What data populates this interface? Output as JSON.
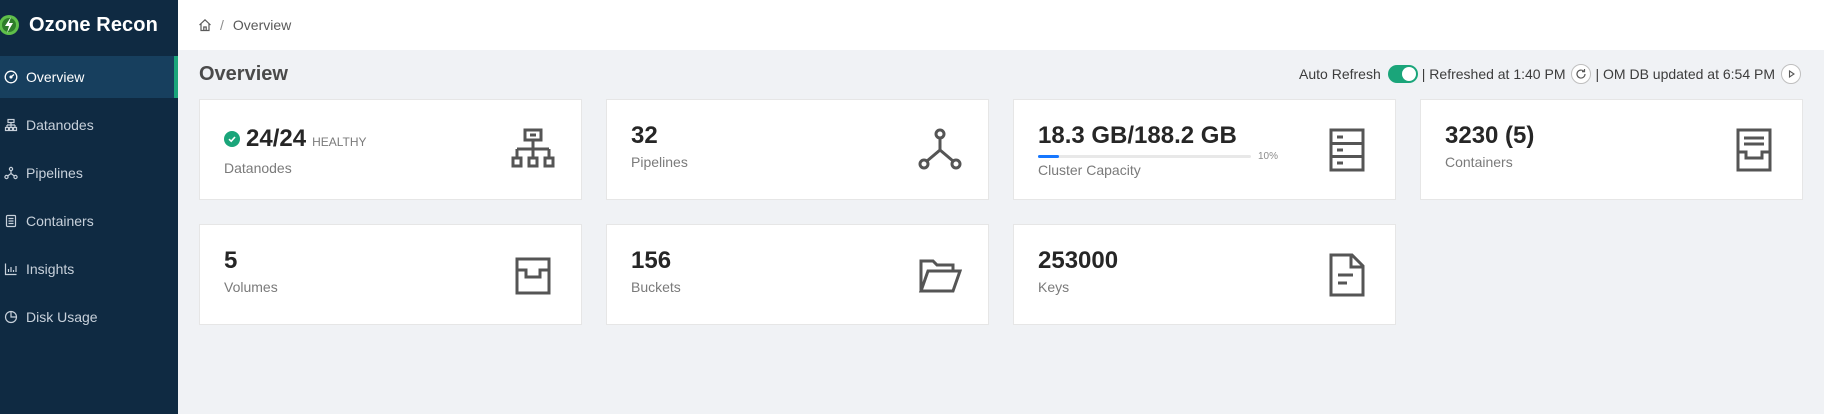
{
  "app": {
    "name": "Ozone Recon"
  },
  "sidebar": {
    "items": [
      {
        "label": "Overview",
        "icon": "dashboard-icon",
        "active": true
      },
      {
        "label": "Datanodes",
        "icon": "cluster-icon"
      },
      {
        "label": "Pipelines",
        "icon": "deployment-unit-icon"
      },
      {
        "label": "Containers",
        "icon": "container-icon"
      },
      {
        "label": "Insights",
        "icon": "bar-chart-icon"
      },
      {
        "label": "Disk Usage",
        "icon": "pie-chart-icon"
      }
    ]
  },
  "breadcrumb": {
    "separator": "/",
    "current": "Overview"
  },
  "page": {
    "title": "Overview"
  },
  "refresh": {
    "auto_label": "Auto Refresh",
    "auto_enabled": true,
    "refreshed_text": "| Refreshed at 1:40 PM",
    "om_text": "| OM DB updated at 6:54 PM"
  },
  "cards": {
    "datanodes": {
      "value": "24/24",
      "status": "HEALTHY",
      "label": "Datanodes",
      "icon": "cluster-icon"
    },
    "pipelines": {
      "value": "32",
      "label": "Pipelines",
      "icon": "deployment-unit-icon"
    },
    "capacity": {
      "value": "18.3 GB/188.2 GB",
      "percent_text": "10%",
      "percent": 10,
      "label": "Cluster Capacity",
      "icon": "database-icon"
    },
    "containers": {
      "value": "3230 (5)",
      "label": "Containers",
      "icon": "container-icon"
    },
    "volumes": {
      "value": "5",
      "label": "Volumes",
      "icon": "inbox-icon"
    },
    "buckets": {
      "value": "156",
      "label": "Buckets",
      "icon": "folder-open-icon"
    },
    "keys": {
      "value": "253000",
      "label": "Keys",
      "icon": "file-text-icon"
    }
  },
  "colors": {
    "sidebar": "#0f2a42",
    "sidebar_active": "#173f5e",
    "accent": "#1aa57a",
    "progress": "#1677ff"
  }
}
